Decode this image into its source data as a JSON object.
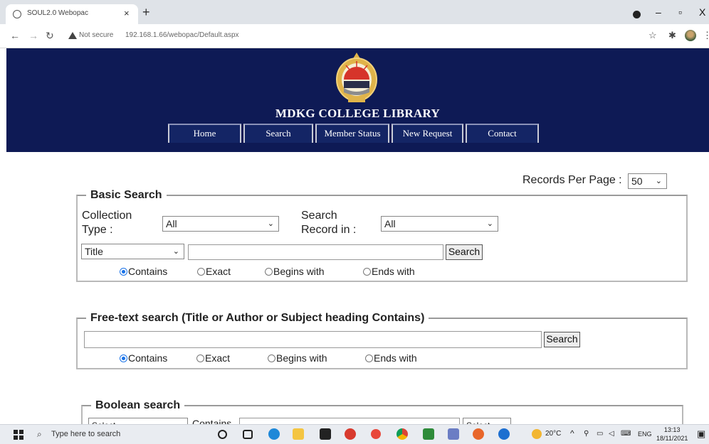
{
  "browser": {
    "tab_title": "SOUL2.0 Webopac",
    "tab_close": "×",
    "new_tab": "+",
    "not_secure": "Not secure",
    "url": "192.168.1.66/webopac/Default.aspx",
    "window_controls": {
      "minimize": "–",
      "maximize": "▫",
      "close": "X"
    }
  },
  "header": {
    "library_title": "MDKG COLLEGE LIBRARY",
    "nav": [
      "Home",
      "Search",
      "Member Status",
      "New Request",
      "Contact"
    ],
    "colors": {
      "background": "#0e1a55"
    }
  },
  "records_per_page": {
    "label": "Records Per Page :",
    "value": "50"
  },
  "basic_search": {
    "legend": "Basic Search",
    "collection_type_label": "Collection Type :",
    "collection_type_value": "All",
    "search_record_in_label": "Search Record in :",
    "search_record_in_value": "All",
    "field_value": "Title",
    "query_value": "",
    "search_button": "Search",
    "match_options": [
      "Contains",
      "Exact",
      "Begins with",
      "Ends with"
    ],
    "selected_option": "Contains"
  },
  "free_text_search": {
    "legend": "Free-text search (Title or Author or Subject heading Contains)",
    "query_value": "",
    "search_button": "Search",
    "match_options": [
      "Contains",
      "Exact",
      "Begins with",
      "Ends with"
    ],
    "selected_option": "Contains"
  },
  "boolean_search": {
    "legend": "Boolean search",
    "select_value": "Select",
    "contains_label": "Contains",
    "second_select_value": "Select"
  },
  "taskbar": {
    "search_placeholder": "Type here to search",
    "weather": "20°C",
    "language": "ENG",
    "time": "13:13",
    "date": "18/11/2021"
  }
}
